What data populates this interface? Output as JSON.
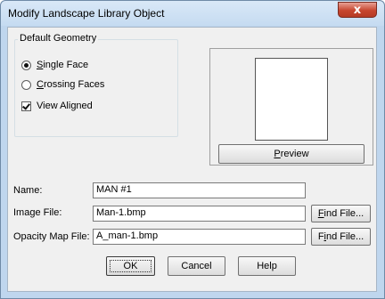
{
  "window": {
    "title": "Modify Landscape Library Object",
    "close_glyph": "x"
  },
  "geometry_group": {
    "legend": "Default Geometry",
    "options": [
      {
        "label": "Single Face",
        "selected": true
      },
      {
        "label": "Crossing Faces",
        "selected": false
      }
    ],
    "view_aligned": {
      "label": "View Aligned",
      "checked": true
    }
  },
  "preview": {
    "button_label": "Preview"
  },
  "fields": {
    "name": {
      "label": "Name:",
      "value": "MAN #1"
    },
    "image_file": {
      "label": "Image File:",
      "value": "Man-1.bmp",
      "button": "Find File..."
    },
    "opacity_map": {
      "label": "Opacity Map File:",
      "value": "A_man-1.bmp",
      "button": "Find File..."
    }
  },
  "buttons": {
    "ok": "OK",
    "cancel": "Cancel",
    "help": "Help"
  },
  "colors": {
    "frame": "#bfd6ee",
    "client": "#f0f0f0",
    "close": "#c7462f"
  },
  "icons": {
    "close": "close-icon"
  }
}
